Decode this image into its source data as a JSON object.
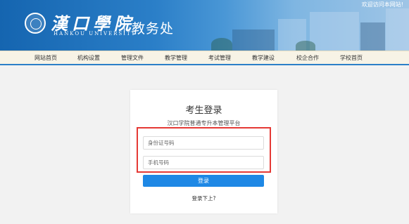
{
  "header": {
    "welcome": "欢迎访问本网站!",
    "school_name": "漢口學院",
    "school_en": "HANKOU UNIVERSITY",
    "department": "教务处"
  },
  "nav": {
    "items": [
      {
        "label": "网站首页"
      },
      {
        "label": "机构设置"
      },
      {
        "label": "管理文件"
      },
      {
        "label": "教学管理"
      },
      {
        "label": "考试管理"
      },
      {
        "label": "教学建设"
      },
      {
        "label": "校企合作"
      },
      {
        "label": "学校首页"
      }
    ]
  },
  "login": {
    "title": "考生登录",
    "subtitle": "汉口学院普通专升本管理平台",
    "id_placeholder": "身份证号码",
    "phone_placeholder": "手机号码",
    "submit_label": "登录",
    "download_link": "登录下上?"
  },
  "colors": {
    "brand_blue": "#1565b0",
    "button_blue": "#1e88e5",
    "highlight_red": "#e53935",
    "nav_bg": "#f7f3e6"
  }
}
